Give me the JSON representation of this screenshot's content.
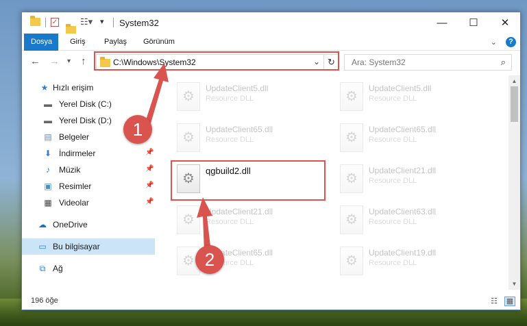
{
  "window": {
    "title": "System32",
    "minimize_glyph": "—",
    "maximize_glyph": "☐",
    "close_glyph": "✕"
  },
  "ribbon": {
    "tabs": [
      {
        "label": "Dosya",
        "active": true
      },
      {
        "label": "Giriş",
        "active": false
      },
      {
        "label": "Paylaş",
        "active": false
      },
      {
        "label": "Görünüm",
        "active": false
      }
    ],
    "help_label": "?"
  },
  "address_bar": {
    "path": "C:\\Windows\\System32",
    "search_placeholder": "Ara: System32"
  },
  "nav_pane": {
    "items": [
      {
        "label": "Hızlı erişim",
        "icon": "star-icon",
        "glyph": "★",
        "color": "#2f7fcf"
      },
      {
        "label": "Yerel Disk (C:)",
        "icon": "drive-icon",
        "glyph": "▬",
        "color": "#666666"
      },
      {
        "label": "Yerel Disk (D:)",
        "icon": "drive-icon",
        "glyph": "▬",
        "color": "#666666"
      },
      {
        "label": "Belgeler",
        "icon": "documents-icon",
        "glyph": "▤",
        "color": "#6d8aa6"
      },
      {
        "label": "İndirmeler",
        "icon": "download-icon",
        "glyph": "⬇",
        "color": "#2f7fcf"
      },
      {
        "label": "Müzik",
        "icon": "music-icon",
        "glyph": "♪",
        "color": "#2f7fcf"
      },
      {
        "label": "Resimler",
        "icon": "pictures-icon",
        "glyph": "▣",
        "color": "#4a90c8"
      },
      {
        "label": "Videolar",
        "icon": "video-icon",
        "glyph": "▦",
        "color": "#444444"
      },
      {
        "label": "OneDrive",
        "icon": "cloud-icon",
        "glyph": "☁",
        "color": "#1f6fc0"
      },
      {
        "label": "Bu bilgisayar",
        "icon": "computer-icon",
        "glyph": "▭",
        "color": "#2f7fcf"
      },
      {
        "label": "Ağ",
        "icon": "network-icon",
        "glyph": "⧉",
        "color": "#2f7fcf"
      }
    ]
  },
  "files": [
    {
      "name": "UpdateClient5.dll",
      "desc": "Resource DLL",
      "faded": true
    },
    {
      "name": "UpdateClient5.dll",
      "desc": "Resource DLL",
      "faded": true
    },
    {
      "name": "UpdateClient65.dll",
      "desc": "Resource DLL",
      "faded": true
    },
    {
      "name": "UpdateClient65.dll",
      "desc": "Resource DLL",
      "faded": true
    },
    {
      "name": "qgbuild2.dll",
      "desc": "",
      "faded": false
    },
    {
      "name": "UpdateClient21.dll",
      "desc": "Resource DLL",
      "faded": true
    },
    {
      "name": "UpdateClient21.dll",
      "desc": "Resource DLL",
      "faded": true
    },
    {
      "name": "UpdateClient63.dll",
      "desc": "Resource DLL",
      "faded": true
    },
    {
      "name": "UpdateClient65.dll",
      "desc": "Resource DLL",
      "faded": true
    },
    {
      "name": "UpdateClient19.dll",
      "desc": "Resource DLL",
      "faded": true
    }
  ],
  "status_bar": {
    "item_count": "196 öğe"
  },
  "annotations": {
    "step1_label": "1",
    "step2_label": "2",
    "color": "#d9534f"
  }
}
